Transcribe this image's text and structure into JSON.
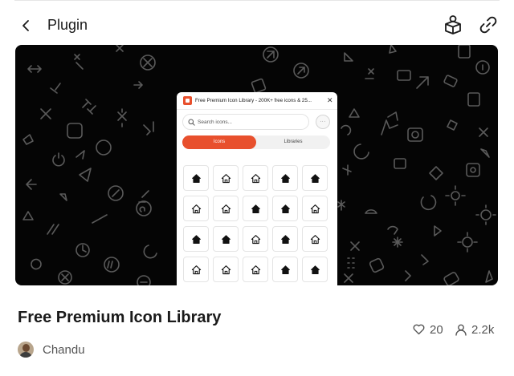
{
  "header": {
    "title": "Plugin",
    "back_icon": "chevron-left-icon",
    "install_icon": "user-box-icon",
    "link_icon": "link-icon"
  },
  "banner": {
    "background": "#050505",
    "pattern_color": "#5a5a5a",
    "mock": {
      "title": "Free Premium Icon Library - 200K+ free icons & 25...",
      "close_label": "✕",
      "search_placeholder": "Search icons...",
      "more_label": "···",
      "tabs": [
        {
          "label": "Icons",
          "active": true
        },
        {
          "label": "Libraries",
          "active": false
        }
      ],
      "accent": "#e8502d",
      "icon_grid": [
        [
          "home-solid",
          "home-outline",
          "home-outline",
          "home-solid",
          "home-solid"
        ],
        [
          "home-outline",
          "home-outline",
          "home-solid",
          "home-solid",
          "home-outline"
        ],
        [
          "home-solid",
          "home-solid",
          "home-outline",
          "home-solid",
          "home-outline"
        ],
        [
          "home-outline",
          "home-outline",
          "home-outline",
          "home-solid",
          "home-solid"
        ]
      ]
    }
  },
  "plugin": {
    "name": "Free Premium Icon Library",
    "likes": "20",
    "users": "2.2k",
    "author": "Chandu",
    "likes_icon": "heart-icon",
    "users_icon": "user-icon"
  }
}
